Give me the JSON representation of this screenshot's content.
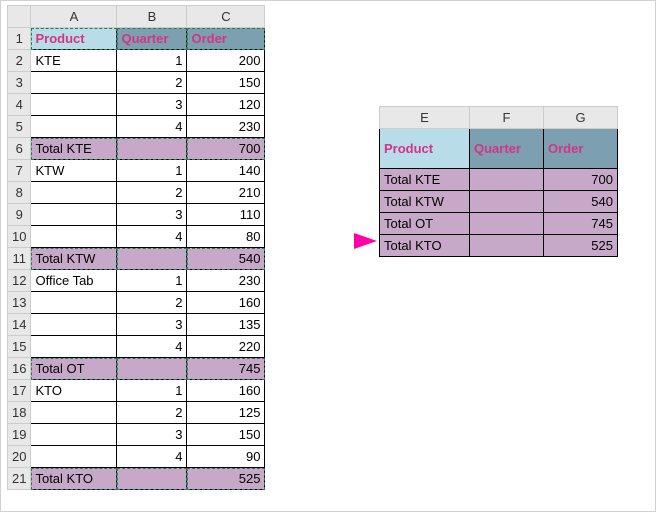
{
  "sheet1": {
    "cols": [
      "A",
      "B",
      "C"
    ],
    "header": {
      "a": "Product",
      "b": "Quarter",
      "c": "Order"
    },
    "rows": [
      {
        "n": "2",
        "a": "KTE",
        "b": "1",
        "c": "200"
      },
      {
        "n": "3",
        "a": "",
        "b": "2",
        "c": "150"
      },
      {
        "n": "4",
        "a": "",
        "b": "3",
        "c": "120"
      },
      {
        "n": "5",
        "a": "",
        "b": "4",
        "c": "230"
      },
      {
        "n": "6",
        "a": "Total KTE",
        "b": "",
        "c": "700",
        "total": true
      },
      {
        "n": "7",
        "a": "KTW",
        "b": "1",
        "c": "140"
      },
      {
        "n": "8",
        "a": "",
        "b": "2",
        "c": "210"
      },
      {
        "n": "9",
        "a": "",
        "b": "3",
        "c": "110"
      },
      {
        "n": "10",
        "a": "",
        "b": "4",
        "c": "80"
      },
      {
        "n": "11",
        "a": "Total KTW",
        "b": "",
        "c": "540",
        "total": true
      },
      {
        "n": "12",
        "a": "Office Tab",
        "b": "1",
        "c": "230"
      },
      {
        "n": "13",
        "a": "",
        "b": "2",
        "c": "160"
      },
      {
        "n": "14",
        "a": "",
        "b": "3",
        "c": "135"
      },
      {
        "n": "15",
        "a": "",
        "b": "4",
        "c": "220"
      },
      {
        "n": "16",
        "a": "Total OT",
        "b": "",
        "c": "745",
        "total": true
      },
      {
        "n": "17",
        "a": "KTO",
        "b": "1",
        "c": "160"
      },
      {
        "n": "18",
        "a": "",
        "b": "2",
        "c": "125"
      },
      {
        "n": "19",
        "a": "",
        "b": "3",
        "c": "150"
      },
      {
        "n": "20",
        "a": "",
        "b": "4",
        "c": "90"
      },
      {
        "n": "21",
        "a": "Total KTO",
        "b": "",
        "c": "525",
        "total": true
      }
    ],
    "headerRowNum": "1"
  },
  "sheet2": {
    "cols": [
      "E",
      "F",
      "G"
    ],
    "header": {
      "e": "Product",
      "f": "Quarter",
      "g": "Order"
    },
    "rows": [
      {
        "a": "Total KTE",
        "c": "700"
      },
      {
        "a": "Total KTW",
        "c": "540"
      },
      {
        "a": "Total OT",
        "c": "745"
      },
      {
        "a": "Total KTO",
        "c": "525"
      }
    ]
  }
}
